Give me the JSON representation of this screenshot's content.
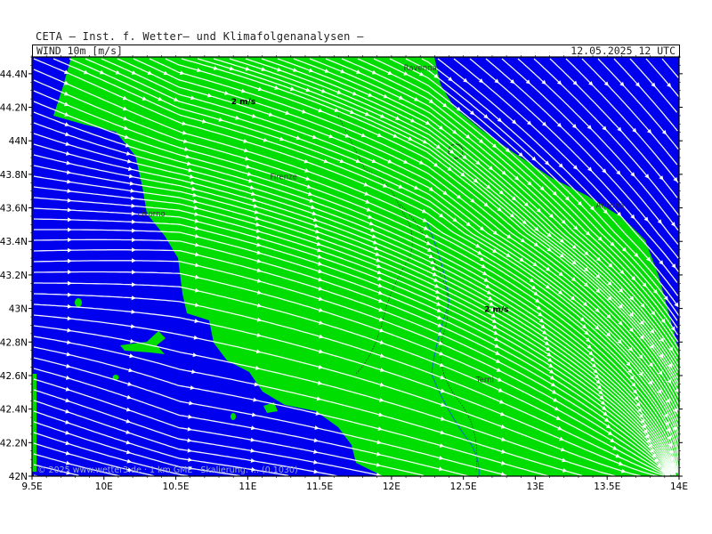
{
  "header": {
    "institute": "CETA — Inst. f. Wetter— und Klimafolgenanalysen —",
    "variable": "WIND 10m [m/s]",
    "datetime": "12.05.2025 12 UTC"
  },
  "axes": {
    "x_ticks": [
      "9.5E",
      "10E",
      "10.5E",
      "11E",
      "11.5E",
      "12E",
      "12.5E",
      "13E",
      "13.5E",
      "14E"
    ],
    "y_ticks": [
      "42N",
      "42.2N",
      "42.4N",
      "42.6N",
      "42.8N",
      "43N",
      "43.2N",
      "43.4N",
      "43.6N",
      "43.8N",
      "44N",
      "44.2N",
      "44.4N"
    ],
    "x_range": [
      9.5,
      14.0
    ],
    "y_range": [
      42.0,
      44.5
    ]
  },
  "cities": [
    {
      "name": "Ravenna",
      "lon": 12.2,
      "lat": 44.42
    },
    {
      "name": "Firenze",
      "lon": 11.25,
      "lat": 43.77
    },
    {
      "name": "Livorno",
      "lon": 10.33,
      "lat": 43.55
    },
    {
      "name": "Ancona",
      "lon": 13.52,
      "lat": 43.6
    },
    {
      "name": "Terni",
      "lon": 12.65,
      "lat": 42.56
    }
  ],
  "wind_labels": [
    {
      "text": "2 m/s",
      "lon": 10.97,
      "lat": 44.22
    },
    {
      "text": "2 m/s",
      "lon": 12.73,
      "lat": 42.98
    }
  ],
  "legend": {
    "land_color": "#00dd00",
    "sea_color": "#0000ee",
    "streamline_color": "#ffffff"
  },
  "credit": "© 2025 www.wetter3.de · 1 km GME · Skalierung: ... (0.1030)"
}
